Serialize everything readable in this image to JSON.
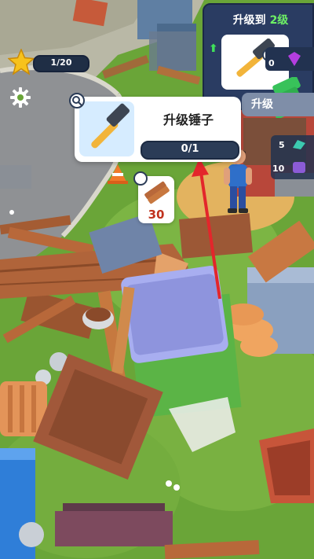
{
  "hud": {
    "level": "",
    "xp_text": "1/20"
  },
  "tooltip": {
    "title": "升级锤子",
    "progress_text": "0/1",
    "progress_fraction": 0
  },
  "upgrade_panel": {
    "title_prefix": "升级到 ",
    "title_level": "2级",
    "button_label": "升级"
  },
  "resource_marker": {
    "count": "30"
  },
  "side_items": [
    {
      "icon": "gem-icon",
      "count": "0"
    },
    {
      "icon": "cash-icon",
      "count": ""
    },
    {
      "icon": "teal-crystal-icon",
      "count": "5"
    },
    {
      "icon": "purple-crystal-icon",
      "count": "10"
    }
  ],
  "colors": {
    "panel_bg": "#2a3c62",
    "level_green": "#6ef065",
    "progress_bg": "#2b3c57",
    "wood_count_red": "#c0321e",
    "arrow_red": "#e3262b"
  }
}
